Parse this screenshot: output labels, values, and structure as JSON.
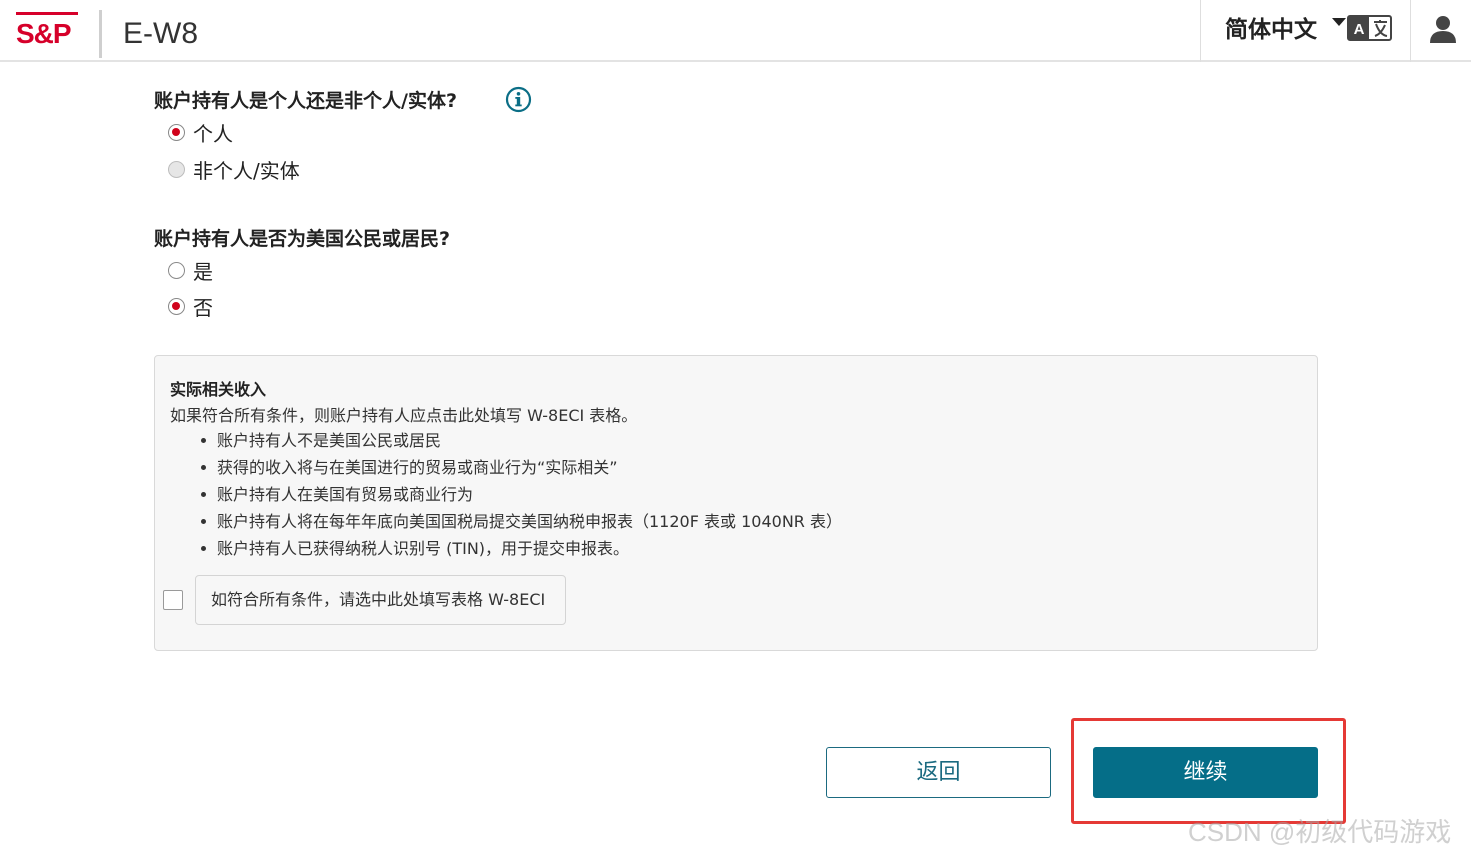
{
  "header": {
    "logo": "S&P",
    "app_title": "E-W8",
    "language": "简体中文",
    "translate_icon": "translate-icon",
    "user_icon": "user-icon"
  },
  "q1": {
    "title": "账户持有人是个人还是非个人/实体?",
    "info_icon": "info-icon",
    "options": [
      {
        "label": "个人",
        "selected": true
      },
      {
        "label": "非个人/实体",
        "selected": false,
        "disabled": true
      }
    ]
  },
  "q2": {
    "title": "账户持有人是否为美国公民或居民?",
    "options": [
      {
        "label": "是",
        "selected": false
      },
      {
        "label": "否",
        "selected": true
      }
    ]
  },
  "eci_panel": {
    "title": "实际相关收入",
    "description": "如果符合所有条件，则账户持有人应点击此处填写 W-8ECI 表格。",
    "conditions": [
      "账户持有人不是美国公民或居民",
      "获得的收入将与在美国进行的贸易或商业行为“实际相关”",
      "账户持有人在美国有贸易或商业行为",
      "账户持有人将在每年年底向美国国税局提交美国纳税申报表（1120F 表或 1040NR 表）",
      "账户持有人已获得纳税人识别号 (TIN)，用于提交申报表。"
    ],
    "checkbox_label": "如符合所有条件，请选中此处填写表格 W-8ECI",
    "checkbox_checked": false
  },
  "buttons": {
    "back": "返回",
    "continue": "继续"
  },
  "watermark": "CSDN @初级代码游戏"
}
